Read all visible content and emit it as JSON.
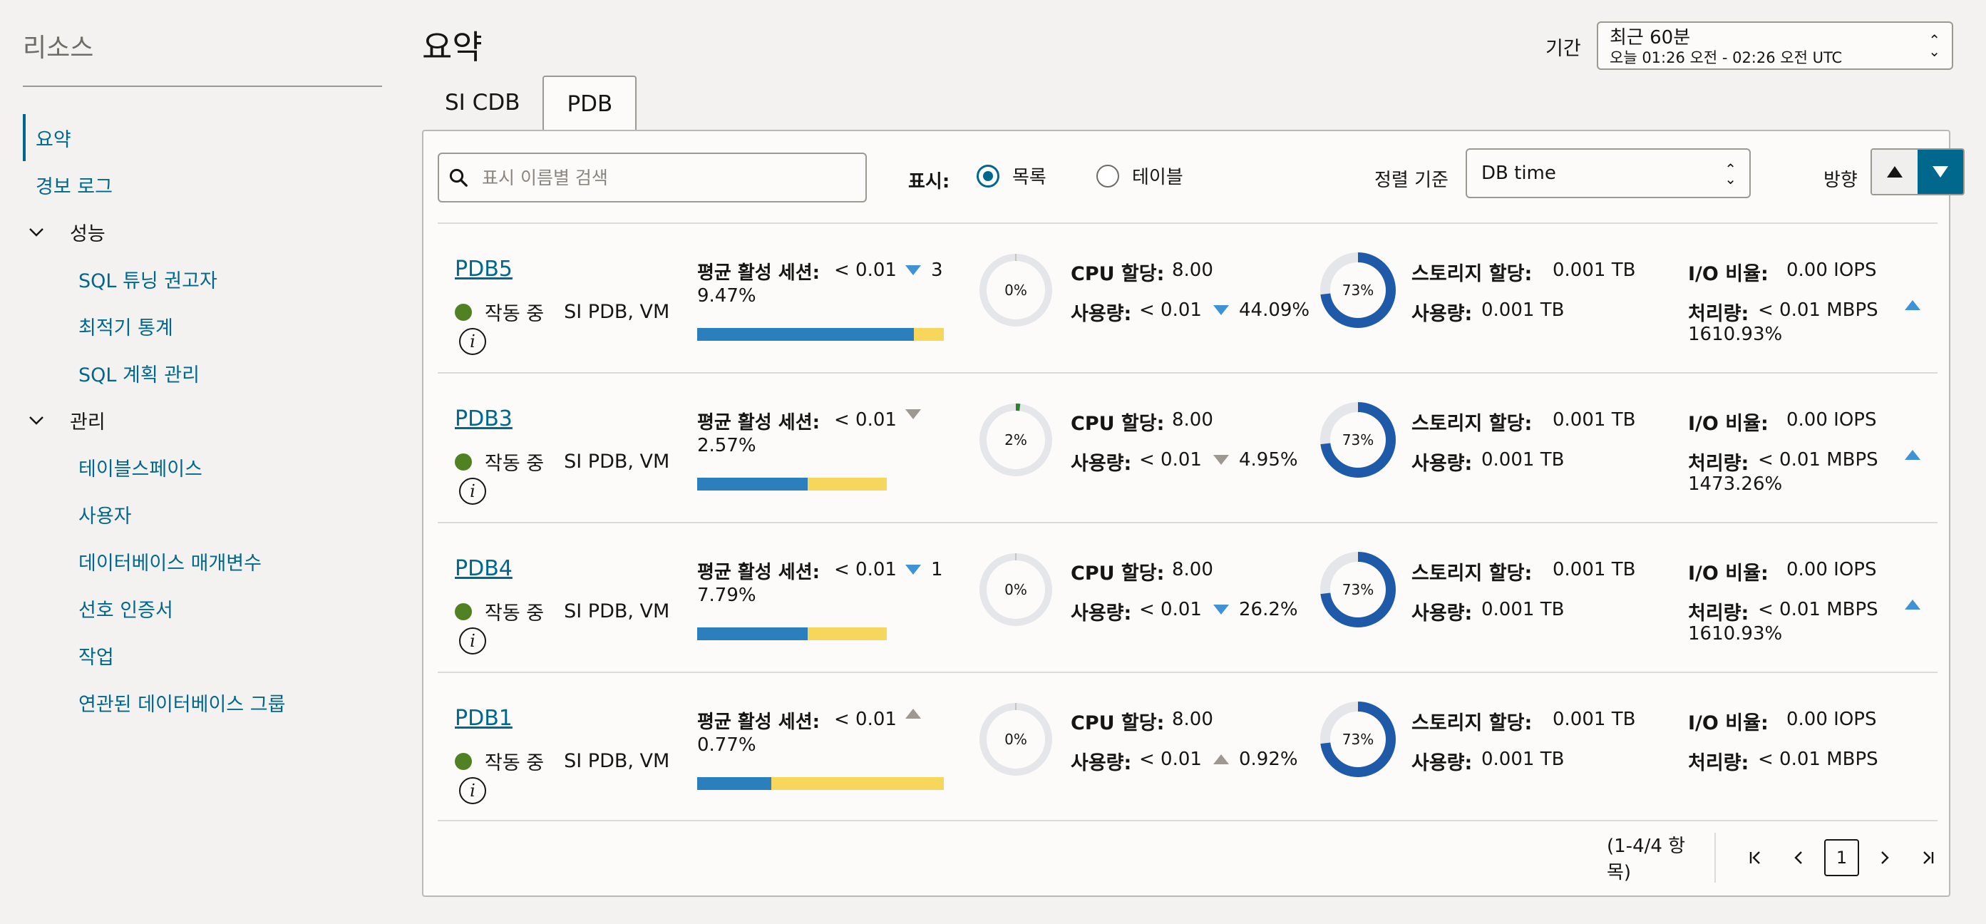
{
  "sidebar": {
    "title": "리소스",
    "items": [
      {
        "label": "요약",
        "type": "item",
        "active": true
      },
      {
        "label": "경보 로그",
        "type": "item"
      },
      {
        "label": "성능",
        "type": "group"
      },
      {
        "label": "SQL 튜닝 권고자",
        "type": "sub"
      },
      {
        "label": "최적기 통계",
        "type": "sub"
      },
      {
        "label": "SQL 계획 관리",
        "type": "sub"
      },
      {
        "label": "관리",
        "type": "group"
      },
      {
        "label": "테이블스페이스",
        "type": "sub"
      },
      {
        "label": "사용자",
        "type": "sub"
      },
      {
        "label": "데이터베이스 매개변수",
        "type": "sub"
      },
      {
        "label": "선호 인증서",
        "type": "sub"
      },
      {
        "label": "작업",
        "type": "sub"
      },
      {
        "label": "연관된 데이터베이스 그룹",
        "type": "sub"
      }
    ]
  },
  "header": {
    "title": "요약",
    "period_label": "기간",
    "period_value": "최근 60분",
    "period_range": "오늘 01:26 오전 - 02:26 오전 UTC"
  },
  "tabs": [
    {
      "label": "SI CDB",
      "active": false
    },
    {
      "label": "PDB",
      "active": true
    }
  ],
  "toolbar": {
    "search_placeholder": "표시 이름별 검색",
    "display_label": "표시:",
    "display_options": [
      "목록",
      "테이블"
    ],
    "display_selected": "목록",
    "sort_label": "정렬 기준",
    "sort_value": "DB time",
    "direction_label": "방향"
  },
  "labels": {
    "sessions": "평균 활성 세션:",
    "cpu_alloc": "CPU 할당:",
    "usage": "사용량:",
    "storage_alloc": "스토리지 할당:",
    "io_rate": "I/O 비율:",
    "throughput": "처리량:"
  },
  "rows": [
    {
      "name": "PDB5",
      "status": "작동 중",
      "type": "SI PDB, VM",
      "sessions": "< 0.01",
      "sessions_trend": "down",
      "sessions_trend_color": "#3f92d6",
      "sessions_trend_val": "3",
      "sessions_pct": "9.47%",
      "bar_blue": 0.88,
      "bar_yellow": 0.12,
      "bar_width": 0.96,
      "cpu_pct_label": "0%",
      "cpu_pct": 0.0,
      "cpu_alloc": "8.00",
      "cpu_use": "< 0.01",
      "cpu_trend": "down",
      "cpu_trend_color": "#3f92d6",
      "cpu_trend_val": "44.09%",
      "st_pct_label": "73%",
      "st_pct": 0.73,
      "st_alloc": "0.001 TB",
      "st_use": "0.001 TB",
      "io": "0.00 IOPS",
      "tp": "< 0.01 MBPS",
      "tp_trend": "up",
      "tp_pct": "1610.93%"
    },
    {
      "name": "PDB3",
      "status": "작동 중",
      "type": "SI PDB, VM",
      "sessions": "< 0.01",
      "sessions_trend": "down",
      "sessions_trend_color": "#9e9892",
      "sessions_trend_val": "",
      "sessions_pct": "2.57%",
      "bar_blue": 0.58,
      "bar_yellow": 0.42,
      "bar_width": 0.74,
      "cpu_pct_label": "2%",
      "cpu_pct": 0.02,
      "cpu_alloc": "8.00",
      "cpu_use": "< 0.01",
      "cpu_trend": "down",
      "cpu_trend_color": "#9e9892",
      "cpu_trend_val": "4.95%",
      "st_pct_label": "73%",
      "st_pct": 0.73,
      "st_alloc": "0.001 TB",
      "st_use": "0.001 TB",
      "io": "0.00 IOPS",
      "tp": "< 0.01 MBPS",
      "tp_trend": "up",
      "tp_pct": "1473.26%"
    },
    {
      "name": "PDB4",
      "status": "작동 중",
      "type": "SI PDB, VM",
      "sessions": "< 0.01",
      "sessions_trend": "down",
      "sessions_trend_color": "#3f92d6",
      "sessions_trend_val": "1",
      "sessions_pct": "7.79%",
      "bar_blue": 0.58,
      "bar_yellow": 0.42,
      "bar_width": 0.74,
      "cpu_pct_label": "0%",
      "cpu_pct": 0.0,
      "cpu_alloc": "8.00",
      "cpu_use": "< 0.01",
      "cpu_trend": "down",
      "cpu_trend_color": "#3f92d6",
      "cpu_trend_val": "26.2%",
      "st_pct_label": "73%",
      "st_pct": 0.73,
      "st_alloc": "0.001 TB",
      "st_use": "0.001 TB",
      "io": "0.00 IOPS",
      "tp": "< 0.01 MBPS",
      "tp_trend": "up",
      "tp_pct": "1610.93%"
    },
    {
      "name": "PDB1",
      "status": "작동 중",
      "type": "SI PDB, VM",
      "sessions": "< 0.01",
      "sessions_trend": "up",
      "sessions_trend_color": "#9e9892",
      "sessions_trend_val": "",
      "sessions_pct": "0.77%",
      "bar_blue": 0.3,
      "bar_yellow": 0.7,
      "bar_width": 0.96,
      "cpu_pct_label": "0%",
      "cpu_pct": 0.0,
      "cpu_alloc": "8.00",
      "cpu_use": "< 0.01",
      "cpu_trend": "up",
      "cpu_trend_color": "#9e9892",
      "cpu_trend_val": "0.92%",
      "st_pct_label": "73%",
      "st_pct": 0.73,
      "st_alloc": "0.001 TB",
      "st_use": "0.001 TB",
      "io": "0.00 IOPS",
      "tp": "< 0.01 MBPS",
      "tp_trend": "",
      "tp_pct": ""
    }
  ],
  "pager": {
    "range": "(1-4/4 항목)",
    "current_page": "1"
  },
  "colors": {
    "accent": "#00688c",
    "donut_storage": "#1e5aa8",
    "donut_track": "#e4e6ea",
    "cpu_tick": "#2e7d32",
    "bar_blue": "#2b7fbd",
    "bar_yellow": "#f7d65c",
    "status_green": "#508223"
  }
}
